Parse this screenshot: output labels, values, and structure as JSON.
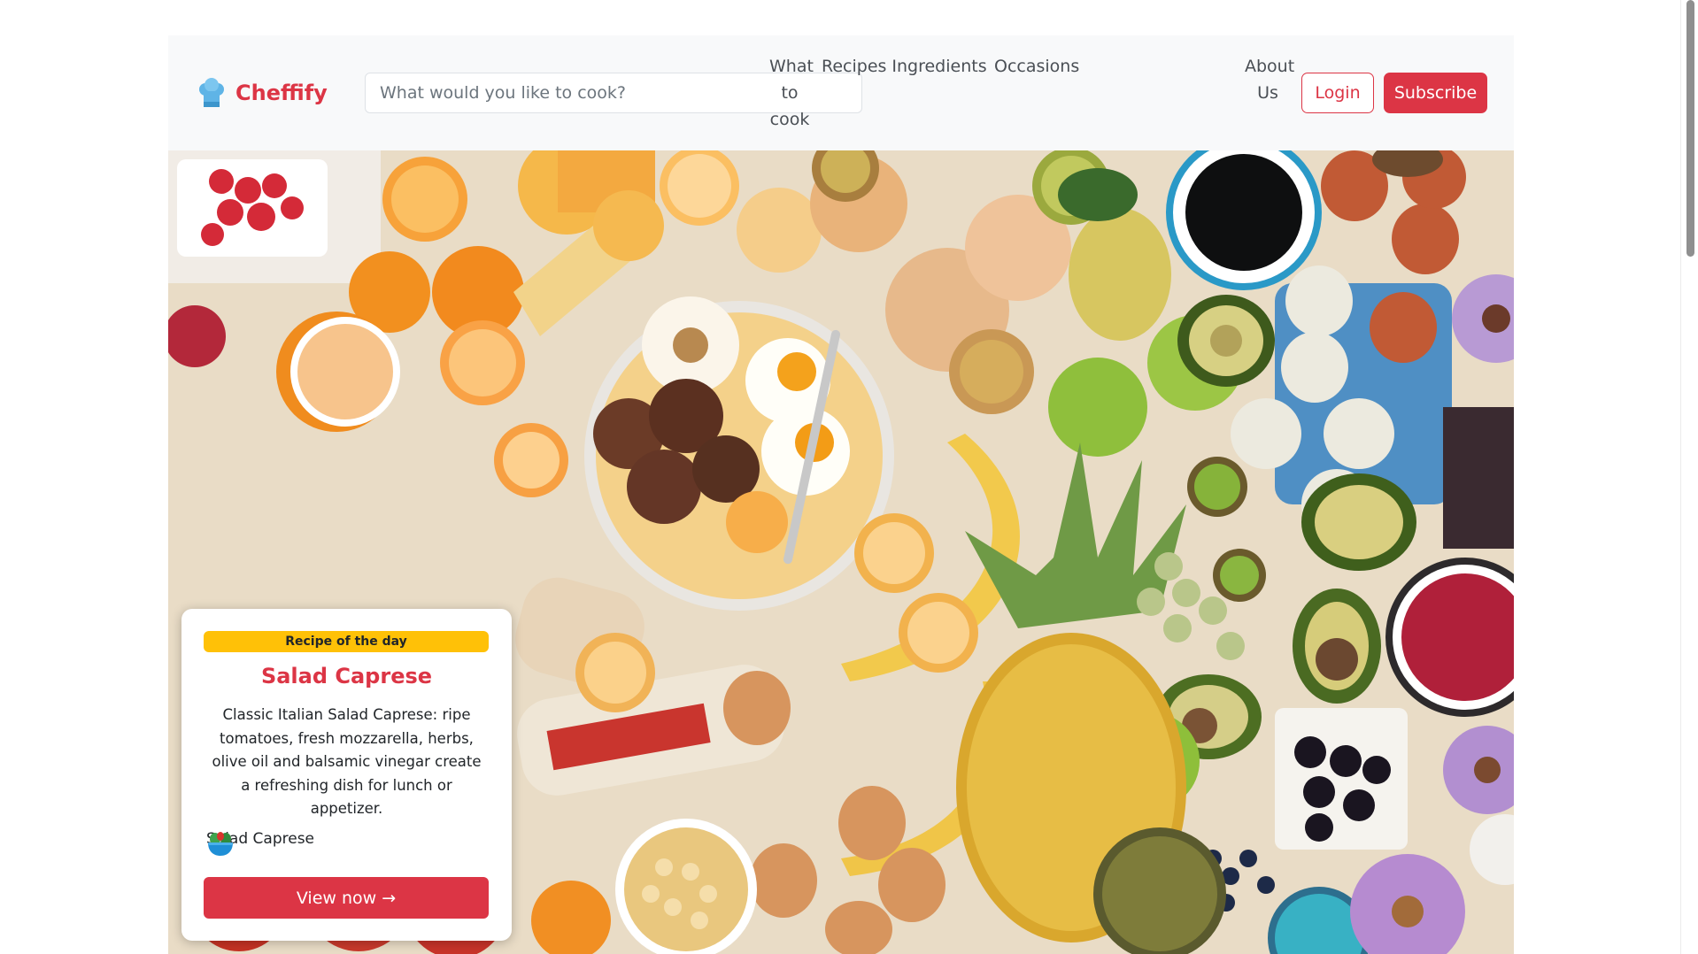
{
  "brand": {
    "name": "Cheffify",
    "icon": "chef-hat-icon"
  },
  "search": {
    "placeholder": "What would you like to cook?"
  },
  "nav": {
    "items": [
      {
        "label": "What to cook"
      },
      {
        "label": "Recipes"
      },
      {
        "label": "Ingredients"
      },
      {
        "label": "Occasions"
      },
      {
        "label": "About Us"
      }
    ],
    "login_label": "Login",
    "subscribe_label": "Subscribe"
  },
  "hero": {
    "image": "breakfast-spread-photo",
    "card": {
      "badge": "Recipe of the day",
      "title": "Salad Caprese",
      "description": "Classic Italian Salad Caprese: ripe tomatoes, fresh mozzarella, herbs, olive oil and balsamic vinegar create a refreshing dish for lunch or appetizer.",
      "author": "Salad Caprese",
      "author_icon": "salad-bowl-icon",
      "button": "View now →"
    }
  },
  "colors": {
    "accent": "#dc3545",
    "badge": "#ffc107",
    "navbar": "#f8f9fa"
  }
}
